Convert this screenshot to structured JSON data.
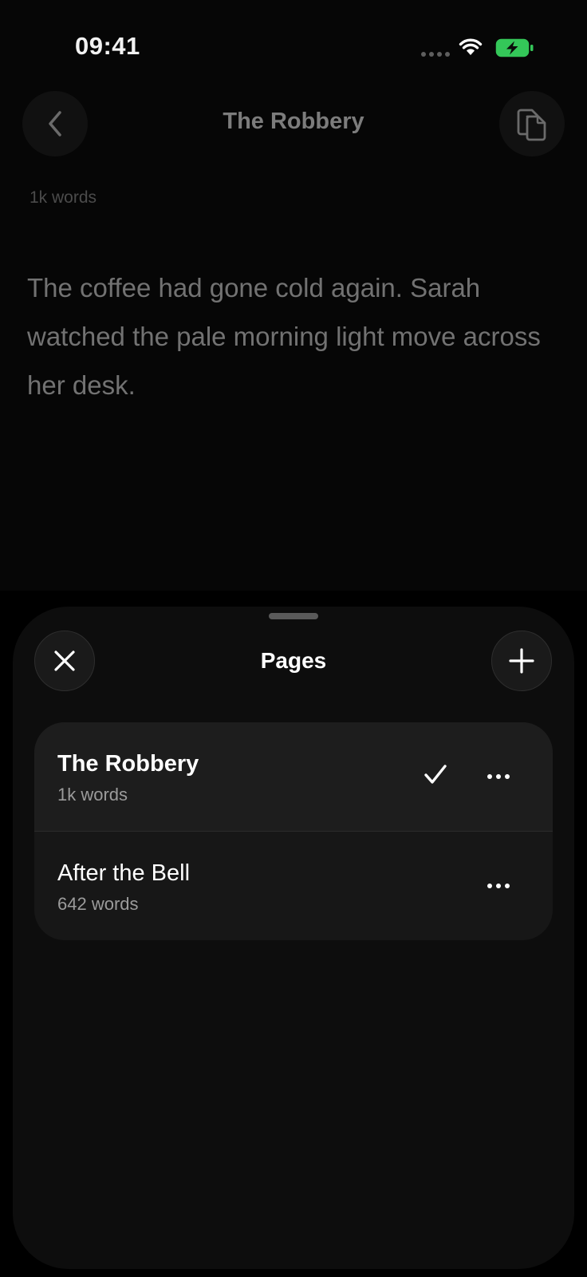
{
  "status_bar": {
    "time": "09:41"
  },
  "nav": {
    "title": "The Robbery"
  },
  "document": {
    "word_count": "1k words",
    "body": "The coffee had gone cold again. Sarah watched the pale morning light move across her desk."
  },
  "sheet": {
    "title": "Pages",
    "pages": [
      {
        "title": "The Robbery",
        "words": "1k words",
        "selected": true
      },
      {
        "title": "After the Bell",
        "words": "642 words",
        "selected": false
      }
    ]
  },
  "colors": {
    "battery_charging": "#34c759",
    "background": "#000000",
    "sheet": "#0d0d0d"
  },
  "icons": [
    "wifi-icon",
    "battery-charging-icon",
    "chevron-left-icon",
    "pages-icon",
    "close-icon",
    "plus-icon",
    "checkmark-icon",
    "more-icon"
  ]
}
